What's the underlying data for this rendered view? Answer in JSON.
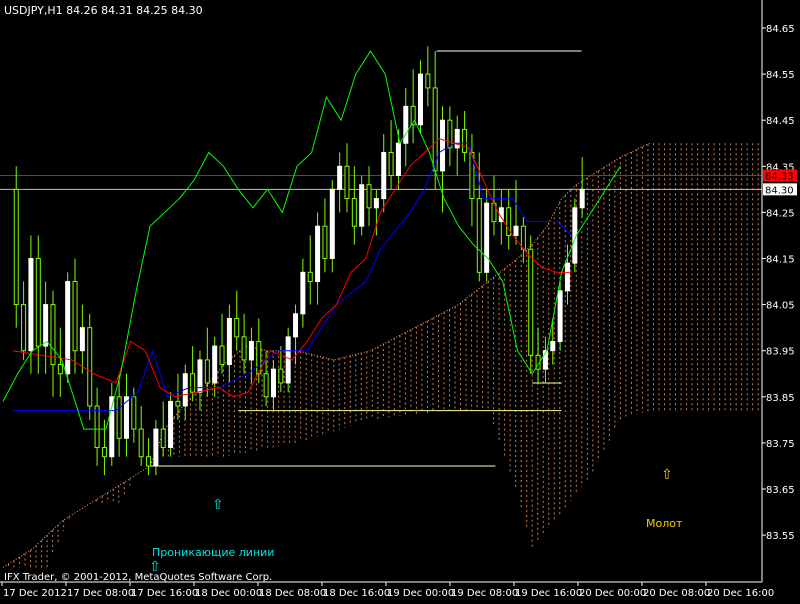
{
  "chart_data": {
    "type": "candlestick",
    "symbol_header": "USDJPY,H1  84.26 84.31 84.25 84.30",
    "copyright": "IFX Trader, © 2001-2012, MetaQuotes Software Corp.",
    "ylim": [
      83.48,
      84.69
    ],
    "yticks": [
      "84.65",
      "84.55",
      "84.45",
      "84.35",
      "84.25",
      "84.15",
      "84.05",
      "83.95",
      "83.85",
      "83.75",
      "83.65",
      "83.55"
    ],
    "xticks": [
      "17 Dec 2012",
      "17 Dec 08:00",
      "17 Dec 16:00",
      "18 Dec 00:00",
      "18 Dec 08:00",
      "18 Dec 16:00",
      "19 Dec 00:00",
      "19 Dec 08:00",
      "19 Dec 16:00",
      "20 Dec 00:00",
      "20 Dec 08:00",
      "20 Dec 16:00"
    ],
    "price_tags": [
      {
        "text": "84.33",
        "price": 84.33,
        "bg": "#ff0000",
        "fg": "#000000"
      },
      {
        "text": "84.30",
        "price": 84.3,
        "bg": "#ffffff",
        "fg": "#000000"
      }
    ],
    "horizontal_lines": [
      {
        "price": 84.33,
        "color": "#ff0000"
      },
      {
        "price": 84.3,
        "color": "#c0c0c0"
      }
    ],
    "annotations": [
      {
        "text": "Проникающие линии",
        "color": "#00e5e5"
      },
      {
        "text": "Молот",
        "color": "#ffcc00"
      }
    ],
    "arrow_symbol": "⇧",
    "colors": {
      "bull": "#ffffff",
      "bear": "#7fff00",
      "tenkan": "#ff0000",
      "kijun": "#0000ff",
      "chikou": "#00ff00",
      "cloud": "#ffa060",
      "support": "#ffff99",
      "resistance": "#ffffff"
    },
    "candles": [
      [
        84.3,
        84.35,
        84.0,
        84.05
      ],
      [
        84.05,
        84.1,
        83.93,
        83.95
      ],
      [
        83.95,
        84.2,
        83.9,
        84.15
      ],
      [
        84.15,
        84.2,
        83.9,
        83.96
      ],
      [
        83.96,
        84.1,
        83.9,
        84.05
      ],
      [
        84.05,
        84.08,
        83.85,
        83.92
      ],
      [
        83.92,
        84.0,
        83.85,
        83.9
      ],
      [
        83.9,
        84.12,
        83.88,
        84.1
      ],
      [
        84.1,
        84.15,
        83.9,
        83.95
      ],
      [
        83.95,
        84.05,
        83.9,
        84.0
      ],
      [
        84.0,
        84.03,
        83.8,
        83.83
      ],
      [
        83.83,
        83.87,
        83.7,
        83.74
      ],
      [
        83.74,
        83.8,
        83.68,
        83.72
      ],
      [
        83.72,
        83.88,
        83.7,
        83.85
      ],
      [
        83.85,
        83.9,
        83.72,
        83.76
      ],
      [
        83.76,
        83.9,
        83.72,
        83.85
      ],
      [
        83.85,
        83.87,
        83.75,
        83.78
      ],
      [
        83.78,
        83.83,
        83.7,
        83.72
      ],
      [
        83.72,
        83.76,
        83.68,
        83.7
      ],
      [
        83.7,
        83.8,
        83.68,
        83.78
      ],
      [
        83.78,
        83.84,
        83.72,
        83.74
      ],
      [
        83.74,
        83.86,
        83.72,
        83.84
      ],
      [
        83.84,
        83.9,
        83.8,
        83.83
      ],
      [
        83.83,
        83.92,
        83.8,
        83.9
      ],
      [
        83.9,
        83.96,
        83.84,
        83.86
      ],
      [
        83.86,
        83.95,
        83.82,
        83.93
      ],
      [
        83.93,
        84.0,
        83.85,
        83.88
      ],
      [
        83.88,
        83.98,
        83.85,
        83.96
      ],
      [
        83.96,
        84.03,
        83.9,
        83.92
      ],
      [
        83.92,
        84.05,
        83.88,
        84.02
      ],
      [
        84.02,
        84.08,
        83.95,
        83.98
      ],
      [
        83.98,
        84.03,
        83.9,
        83.93
      ],
      [
        83.93,
        84.0,
        83.88,
        83.97
      ],
      [
        83.97,
        84.02,
        83.88,
        83.9
      ],
      [
        83.9,
        83.95,
        83.83,
        83.85
      ],
      [
        83.85,
        83.93,
        83.82,
        83.91
      ],
      [
        83.91,
        83.96,
        83.86,
        83.88
      ],
      [
        83.88,
        84.0,
        83.86,
        83.98
      ],
      [
        83.98,
        84.05,
        83.92,
        84.03
      ],
      [
        84.03,
        84.15,
        84.0,
        84.12
      ],
      [
        84.12,
        84.2,
        84.05,
        84.1
      ],
      [
        84.1,
        84.25,
        84.05,
        84.22
      ],
      [
        84.22,
        84.28,
        84.12,
        84.15
      ],
      [
        84.15,
        84.32,
        84.12,
        84.3
      ],
      [
        84.3,
        84.38,
        84.25,
        84.35
      ],
      [
        84.35,
        84.4,
        84.25,
        84.28
      ],
      [
        84.28,
        84.35,
        84.18,
        84.22
      ],
      [
        84.22,
        84.33,
        84.2,
        84.31
      ],
      [
        84.31,
        84.35,
        84.22,
        84.26
      ],
      [
        84.26,
        84.3,
        84.2,
        84.28
      ],
      [
        84.28,
        84.42,
        84.25,
        84.38
      ],
      [
        84.38,
        84.45,
        84.3,
        84.33
      ],
      [
        84.33,
        84.43,
        84.3,
        84.4
      ],
      [
        84.4,
        84.52,
        84.35,
        84.48
      ],
      [
        84.48,
        84.56,
        84.4,
        84.44
      ],
      [
        84.44,
        84.58,
        84.42,
        84.55
      ],
      [
        84.55,
        84.61,
        84.48,
        84.52
      ],
      [
        84.52,
        84.6,
        84.3,
        84.34
      ],
      [
        84.34,
        84.48,
        84.25,
        84.45
      ],
      [
        84.45,
        84.48,
        84.35,
        84.39
      ],
      [
        84.39,
        84.46,
        84.33,
        84.43
      ],
      [
        84.43,
        84.47,
        84.36,
        84.38
      ],
      [
        84.38,
        84.42,
        84.22,
        84.28
      ],
      [
        84.28,
        84.38,
        84.1,
        84.12
      ],
      [
        84.12,
        84.3,
        84.1,
        84.27
      ],
      [
        84.27,
        84.33,
        84.2,
        84.23
      ],
      [
        84.23,
        84.3,
        84.18,
        84.26
      ],
      [
        84.26,
        84.3,
        84.17,
        84.2
      ],
      [
        84.2,
        84.32,
        84.18,
        84.22
      ],
      [
        84.22,
        84.24,
        84.14,
        84.17
      ],
      [
        84.17,
        84.2,
        83.9,
        83.94
      ],
      [
        83.94,
        84.0,
        83.88,
        83.91
      ],
      [
        83.91,
        83.98,
        83.88,
        83.95
      ],
      [
        83.95,
        84.02,
        83.92,
        83.97
      ],
      [
        83.97,
        84.1,
        83.95,
        84.08
      ],
      [
        84.08,
        84.18,
        84.05,
        84.14
      ],
      [
        84.14,
        84.28,
        84.12,
        84.26
      ],
      [
        84.26,
        84.37,
        84.24,
        84.3
      ]
    ],
    "tenkan": [
      [
        0,
        83.95
      ],
      [
        8,
        83.93
      ],
      [
        11,
        83.9
      ],
      [
        14,
        83.88
      ],
      [
        16,
        83.97
      ],
      [
        18,
        83.95
      ],
      [
        20,
        83.87
      ],
      [
        22,
        83.85
      ],
      [
        25,
        83.86
      ],
      [
        28,
        83.87
      ],
      [
        30,
        83.85
      ],
      [
        32,
        83.86
      ],
      [
        35,
        83.95
      ],
      [
        38,
        83.93
      ],
      [
        40,
        83.97
      ],
      [
        42,
        84.02
      ],
      [
        44,
        84.05
      ],
      [
        46,
        84.12
      ],
      [
        48,
        84.15
      ],
      [
        50,
        84.25
      ],
      [
        52,
        84.3
      ],
      [
        54,
        84.35
      ],
      [
        56,
        84.38
      ],
      [
        58,
        84.41
      ],
      [
        60,
        84.4
      ],
      [
        62,
        84.39
      ],
      [
        64,
        84.32
      ],
      [
        66,
        84.25
      ],
      [
        68,
        84.2
      ],
      [
        70,
        84.16
      ],
      [
        72,
        84.13
      ],
      [
        74,
        84.12
      ],
      [
        76,
        84.12
      ]
    ],
    "kijun": [
      [
        0,
        83.82
      ],
      [
        14,
        83.82
      ],
      [
        17,
        83.86
      ],
      [
        19,
        83.95
      ],
      [
        21,
        83.85
      ],
      [
        24,
        83.87
      ],
      [
        28,
        83.87
      ],
      [
        32,
        83.9
      ],
      [
        36,
        83.95
      ],
      [
        40,
        83.95
      ],
      [
        44,
        84.05
      ],
      [
        48,
        84.1
      ],
      [
        50,
        84.17
      ],
      [
        54,
        84.25
      ],
      [
        56,
        84.3
      ],
      [
        58,
        84.38
      ],
      [
        60,
        84.4
      ],
      [
        62,
        84.4
      ],
      [
        64,
        84.28
      ],
      [
        66,
        84.28
      ],
      [
        68,
        84.28
      ],
      [
        70,
        84.23
      ],
      [
        72,
        84.23
      ],
      [
        74,
        84.23
      ],
      [
        76,
        84.2
      ]
    ],
    "chikou": [
      [
        0,
        83.84
      ],
      [
        2,
        83.9
      ],
      [
        4,
        83.95
      ],
      [
        6,
        83.97
      ],
      [
        8,
        83.93
      ],
      [
        11,
        83.78
      ],
      [
        14,
        83.78
      ],
      [
        16,
        83.9
      ],
      [
        18,
        84.07
      ],
      [
        20,
        84.22
      ],
      [
        22,
        84.25
      ],
      [
        24,
        84.28
      ],
      [
        26,
        84.32
      ],
      [
        28,
        84.38
      ],
      [
        30,
        84.35
      ],
      [
        32,
        84.3
      ],
      [
        34,
        84.26
      ],
      [
        36,
        84.3
      ],
      [
        38,
        84.25
      ],
      [
        40,
        84.35
      ],
      [
        42,
        84.38
      ],
      [
        44,
        84.5
      ],
      [
        46,
        84.45
      ],
      [
        48,
        84.55
      ],
      [
        50,
        84.6
      ],
      [
        52,
        84.55
      ],
      [
        54,
        84.4
      ],
      [
        56,
        84.45
      ],
      [
        58,
        84.38
      ],
      [
        60,
        84.28
      ],
      [
        62,
        84.22
      ],
      [
        64,
        84.18
      ],
      [
        66,
        84.15
      ],
      [
        68,
        84.1
      ],
      [
        70,
        83.95
      ],
      [
        72,
        83.9
      ],
      [
        74,
        83.95
      ],
      [
        76,
        84.12
      ],
      [
        78,
        84.2
      ],
      [
        80,
        84.25
      ],
      [
        82,
        84.3
      ],
      [
        84,
        84.35
      ]
    ],
    "cloud": [
      [
        0,
        83.48
      ],
      [
        4,
        83.52
      ],
      [
        8,
        83.58
      ],
      [
        12,
        83.62
      ],
      [
        16,
        83.66
      ],
      [
        20,
        83.7
      ],
      [
        22,
        83.78
      ],
      [
        25,
        83.84
      ],
      [
        28,
        83.88
      ],
      [
        30,
        83.92
      ],
      [
        33,
        83.96
      ],
      [
        36,
        83.95
      ],
      [
        40,
        83.95
      ],
      [
        45,
        83.93
      ],
      [
        50,
        83.95
      ],
      [
        56,
        84.0
      ],
      [
        62,
        84.05
      ],
      [
        66,
        84.1
      ],
      [
        70,
        84.15
      ],
      [
        72,
        84.18
      ],
      [
        74,
        84.22
      ],
      [
        76,
        84.28
      ],
      [
        78,
        84.31
      ],
      [
        80,
        84.33
      ],
      [
        84,
        84.37
      ],
      [
        88,
        84.4
      ]
    ],
    "cloud_base": [
      [
        0,
        83.48
      ],
      [
        6,
        83.48
      ],
      [
        10,
        83.62
      ],
      [
        16,
        83.62
      ],
      [
        18,
        83.68
      ],
      [
        22,
        83.72
      ],
      [
        30,
        83.72
      ],
      [
        40,
        83.75
      ],
      [
        50,
        83.8
      ],
      [
        60,
        83.82
      ],
      [
        66,
        83.82
      ],
      [
        70,
        83.64
      ],
      [
        72,
        83.52
      ],
      [
        76,
        83.6
      ],
      [
        80,
        83.68
      ],
      [
        84,
        83.8
      ],
      [
        88,
        83.82
      ]
    ],
    "support_lines": [
      [
        67,
        83.7
      ],
      [
        72,
        83.88
      ],
      [
        76,
        83.82
      ]
    ],
    "resistance_line": [
      [
        59,
        84.6
      ],
      [
        76,
        84.6
      ]
    ]
  }
}
